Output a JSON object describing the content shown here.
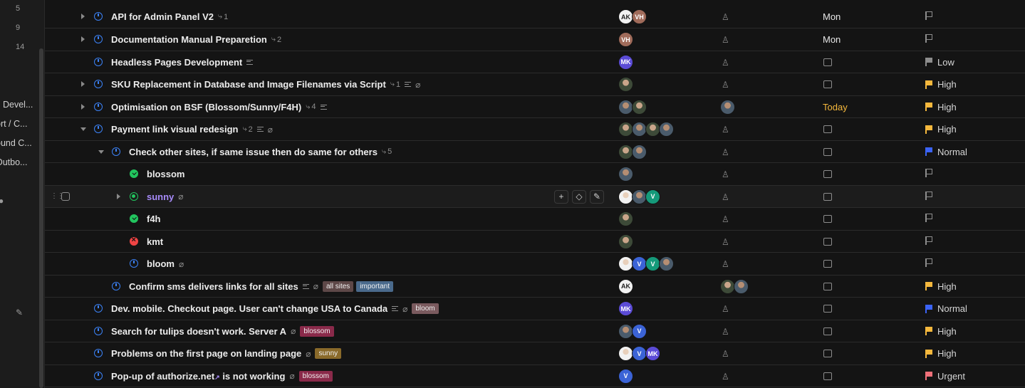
{
  "sidebar": {
    "numbers": [
      "5",
      "9",
      "14"
    ],
    "items": [
      "Devel...",
      "ort / C...",
      "ound C...",
      "Outbo..."
    ]
  },
  "rows": [
    {
      "title": "API for Admin Panel V2",
      "subtasks": "1",
      "avatars": [
        "AK",
        "VH"
      ],
      "due": "Mon",
      "priority": ""
    },
    {
      "title": "Documentation Manual Preparetion",
      "subtasks": "2",
      "avatars": [
        "VH"
      ],
      "due": "Mon",
      "priority": ""
    },
    {
      "title": "Headless Pages Development",
      "avatars": [
        "MK"
      ],
      "priority": "Low"
    },
    {
      "title": "SKU Replacement in Database and Image Filenames via Script",
      "subtasks": "1",
      "priority": "High"
    },
    {
      "title": "Optimisation on BSF (Blossom/Sunny/F4H)",
      "subtasks": "4",
      "due": "Today",
      "priority": "High"
    },
    {
      "title": "Payment link visual redesign",
      "subtasks": "2",
      "priority": "High"
    },
    {
      "title": "Check other sites, if same issue then do same for others",
      "subtasks": "5",
      "priority": "Normal"
    },
    {
      "title": "blossom",
      "priority": ""
    },
    {
      "title": "sunny",
      "avatars": [
        "V"
      ],
      "priority": ""
    },
    {
      "title": "f4h",
      "priority": ""
    },
    {
      "title": "kmt",
      "priority": ""
    },
    {
      "title": "bloom",
      "avatars": [
        "V",
        "V"
      ],
      "priority": ""
    },
    {
      "title": "Confirm sms delivers links for all sites",
      "tags": [
        "all sites",
        "important"
      ],
      "avatars": [
        "AK"
      ],
      "priority": "High"
    },
    {
      "title": "Dev. mobile. Checkout page. User can't change USA to Canada",
      "tags": [
        "bloom"
      ],
      "avatars": [
        "MK"
      ],
      "priority": "Normal"
    },
    {
      "title": "Search for tulips doesn't work. Server A",
      "tags": [
        "blossom"
      ],
      "avatars": [
        "V"
      ],
      "priority": "High"
    },
    {
      "title": "Problems on the first page on landing page",
      "tags": [
        "sunny"
      ],
      "avatars": [
        "V",
        "MK"
      ],
      "priority": "High"
    },
    {
      "title_a": "Pop-up of authorize.net",
      "title_b": " is not working",
      "tags": [
        "blossom"
      ],
      "avatars": [
        "V"
      ],
      "priority": "Urgent"
    }
  ],
  "colors": {
    "accent": "#3b82f6",
    "high": "#f5b83d",
    "normal": "#3b63f5",
    "urgent": "#f0707a",
    "low": "#8d8d8d",
    "done": "#22c55e",
    "error": "#ef4444"
  }
}
